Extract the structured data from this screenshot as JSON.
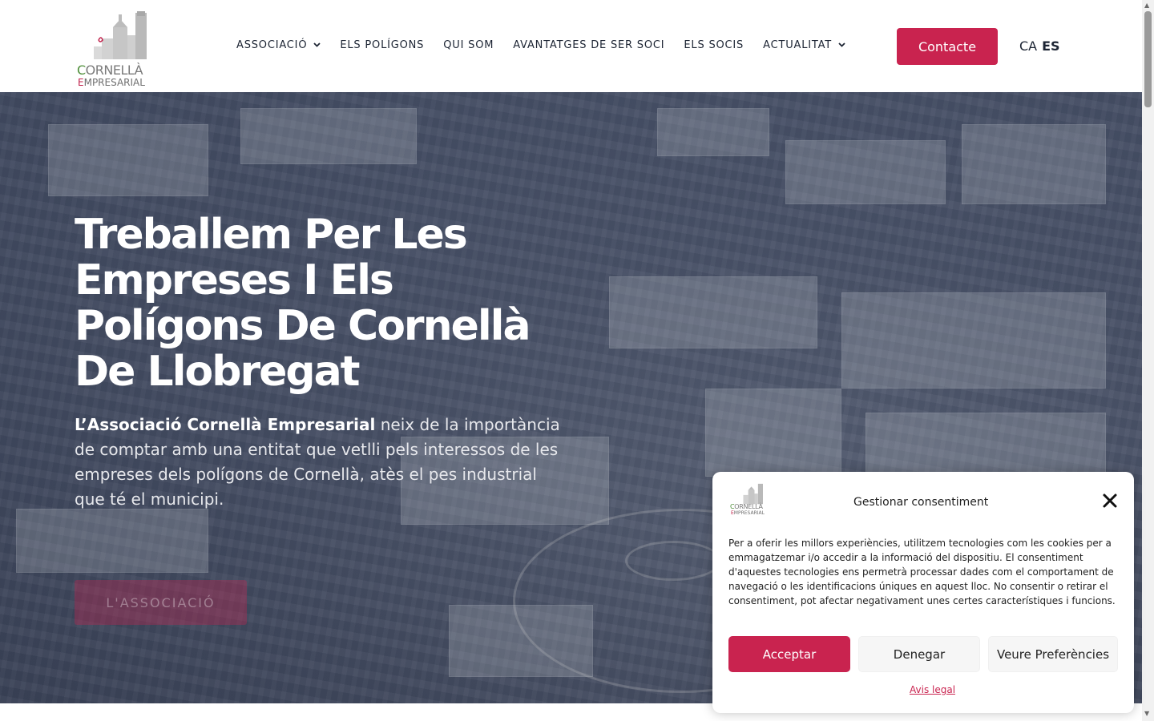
{
  "logo": {
    "line1_first": "C",
    "line1_rest": "ORNELLÀ",
    "line2_first": "E",
    "line2_rest": "MPRESARIAL"
  },
  "nav": {
    "items": [
      {
        "label": "ASSOCIACIÓ",
        "has_dropdown": true
      },
      {
        "label": "ELS POLÍGONS",
        "has_dropdown": false
      },
      {
        "label": "QUI SOM",
        "has_dropdown": false
      },
      {
        "label": "AVANTATGES DE SER SOCI",
        "has_dropdown": false
      },
      {
        "label": "ELS SOCIS",
        "has_dropdown": false
      },
      {
        "label": "ACTUALITAT",
        "has_dropdown": true
      }
    ],
    "contact_label": "Contacte",
    "lang_ca": "CA",
    "lang_es": "ES"
  },
  "hero": {
    "title": "Treballem Per Les Empreses I Els Polígons De Cornellà De Llobregat",
    "intro_bold": "L’Associació Cornellà Empresarial",
    "intro_rest": " neix de la importància de comptar amb una entitat que vetlli pels interessos de les empreses dels polígons de Cornellà, atès el pes industrial que té el municipi.",
    "button_label": "L'ASSOCIACIÓ"
  },
  "consent": {
    "title": "Gestionar consentiment",
    "body": "Per a oferir les millors experiències, utilitzem tecnologies com les cookies per a emmagatzemar i/o accedir a la informació del dispositiu. El consentiment d'aquestes tecnologies ens permetrà processar dades com el comportament de navegació o les identificacions úniques en aquest lloc. No consentir o retirar el consentiment, pot afectar negativament unes certes característiques i funcions.",
    "accept_label": "Acceptar",
    "deny_label": "Denegar",
    "prefs_label": "Veure Preferències",
    "legal_label": "Avis legal"
  },
  "colors": {
    "accent": "#c9234f",
    "nav_text": "#1c2433",
    "logo_green": "#4f8f3a"
  },
  "icons": {
    "dropdown": "chevron-down-icon",
    "close": "close-icon"
  }
}
